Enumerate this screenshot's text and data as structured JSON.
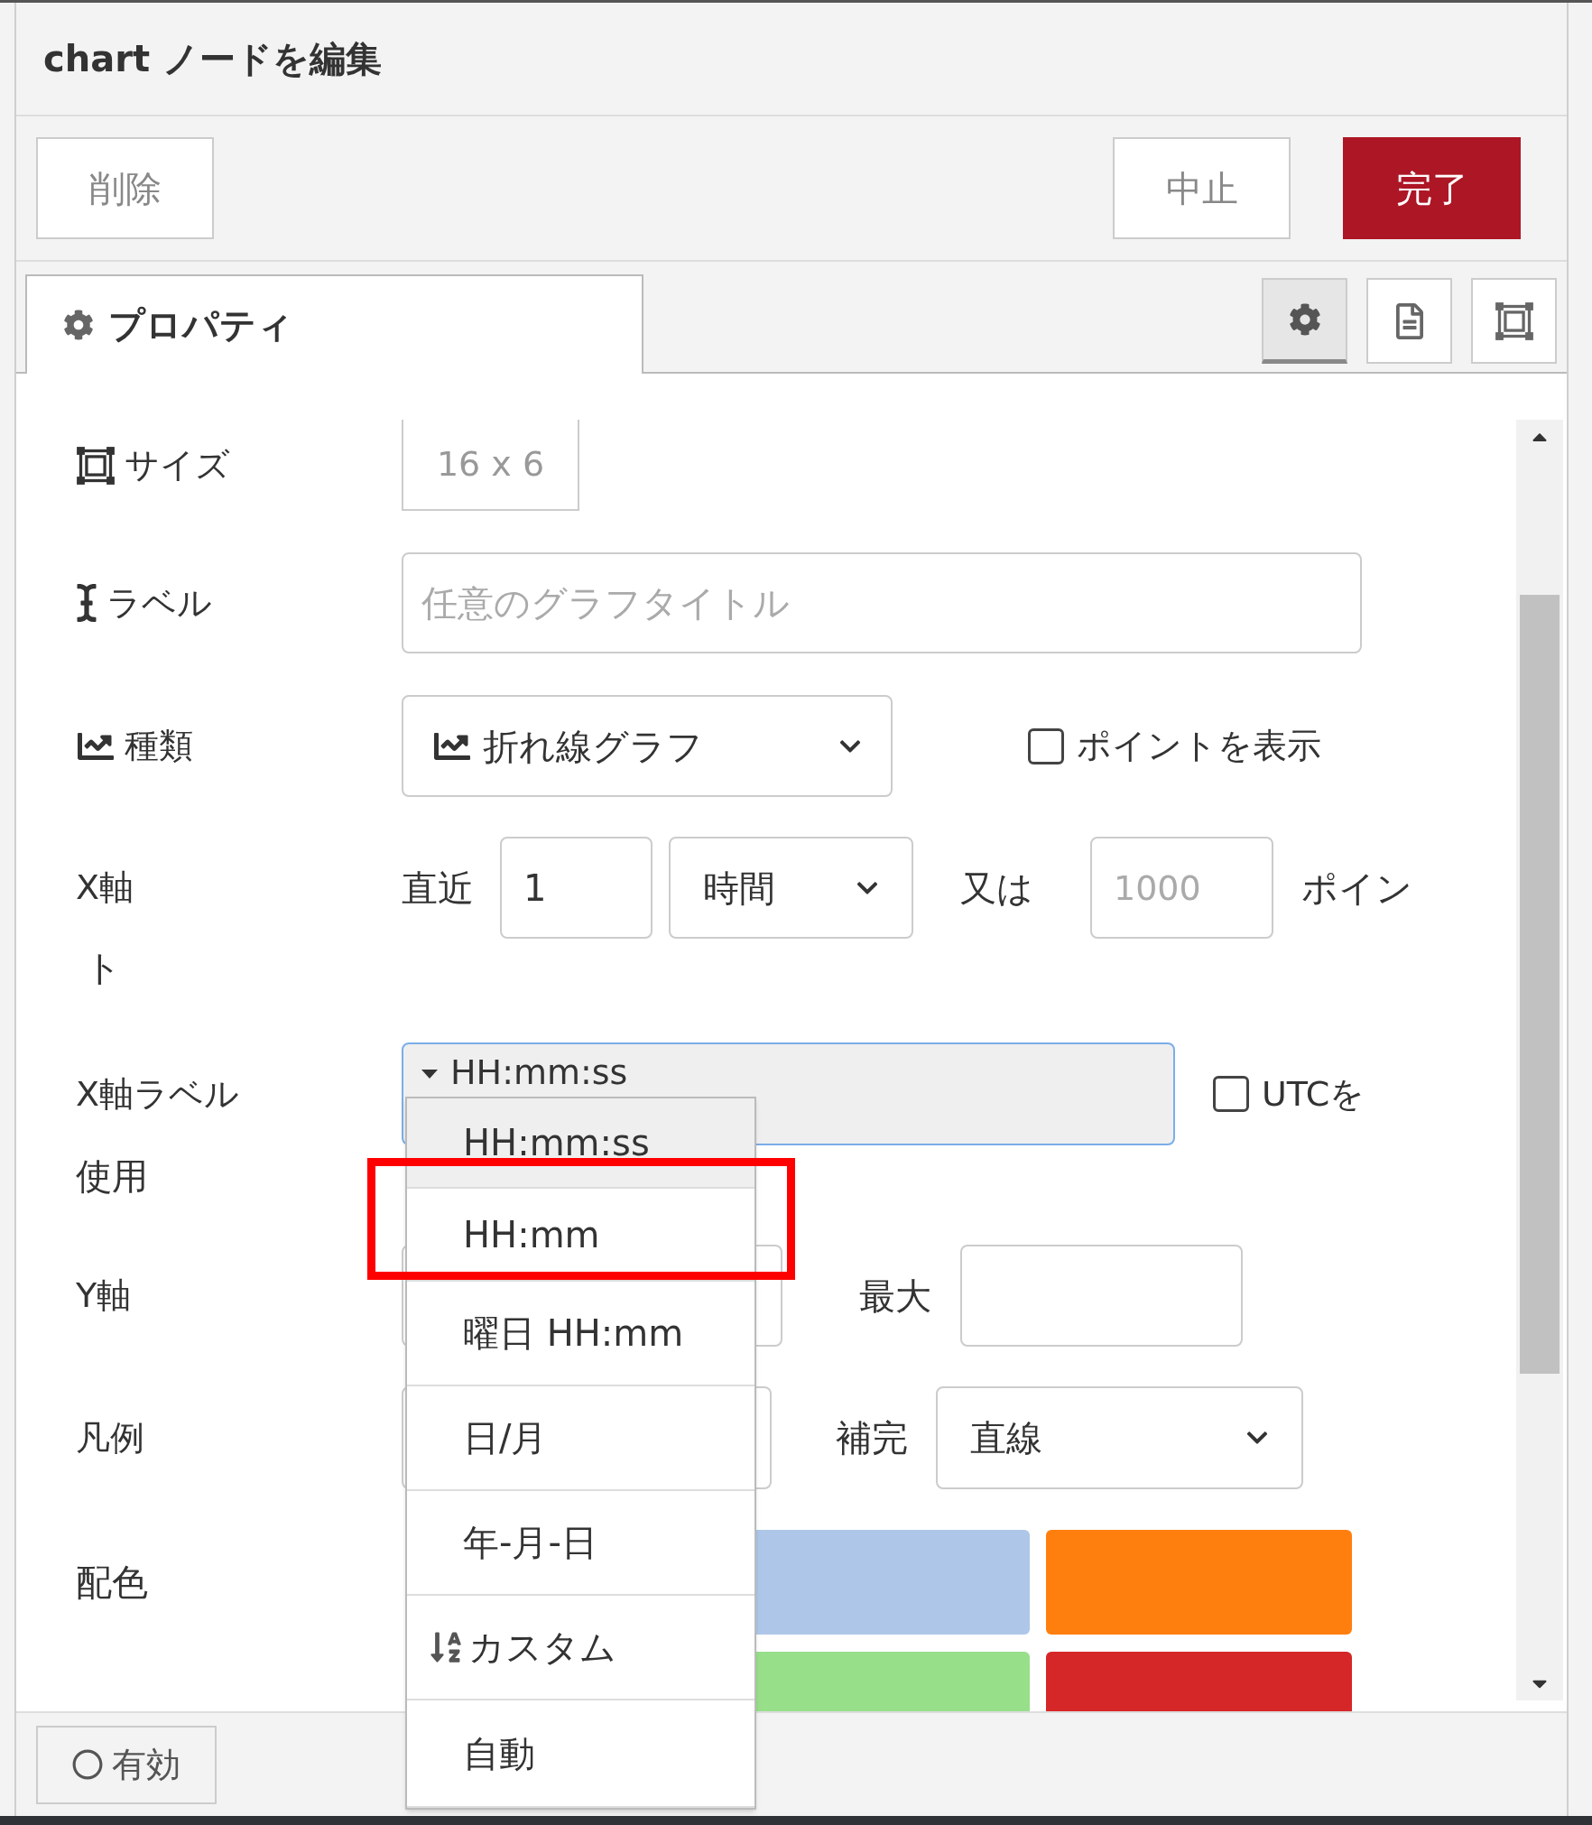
{
  "dialog": {
    "title": "chart ノードを編集"
  },
  "buttons": [
    {
      "label": "削除",
      "kind": "secondary"
    },
    {
      "label": "中止",
      "kind": "secondary"
    },
    {
      "label": "完了",
      "kind": "primary"
    }
  ],
  "tabs": [
    {
      "label": "プロパティ",
      "selected": true
    }
  ],
  "side_tabs": [
    {
      "kind": "gear",
      "selected": true
    },
    {
      "kind": "document",
      "selected": false
    },
    {
      "kind": "frame",
      "selected": false
    }
  ],
  "size": {
    "label": "サイズ",
    "value": "16 x 6"
  },
  "label_field": {
    "label": "ラベル",
    "placeholder": "任意のグラフタイトル"
  },
  "type": {
    "label": "種類",
    "value": "折れ線グラフ",
    "checkbox": {
      "label": "ポイントを表示",
      "checked": false
    }
  },
  "x_axis": {
    "label": "X軸",
    "label_wrap": "ト",
    "last_label": "直近",
    "last_value": "1",
    "unit": "時間",
    "or_label": "又は",
    "points_placeholder": "1000",
    "points_label": "ポイン"
  },
  "x_label": {
    "label": "X軸ラベル",
    "label_wrap": "使用",
    "value": "HH:mm:ss",
    "utc": {
      "label": "UTCを",
      "checked": false
    }
  },
  "y_axis": {
    "label": "Y軸",
    "max_label": "最大"
  },
  "legend": {
    "label": "凡例",
    "interpolate_label": "補完",
    "interpolate_value": "直線"
  },
  "colors": {
    "label": "配色",
    "swatches": [
      {
        "color": "#aec7e8"
      },
      {
        "color": "#ff7f0e"
      },
      {
        "color": "#98df8a"
      },
      {
        "color": "#d62728"
      }
    ]
  },
  "footer": {
    "toggle_label": "有効"
  },
  "dropdown": {
    "options": [
      {
        "label": "HH:mm:ss",
        "selected": true,
        "highlighted": false
      },
      {
        "label": "HH:mm",
        "selected": false,
        "highlighted": true
      },
      {
        "label": "曜日 HH:mm",
        "selected": false,
        "highlighted": false
      },
      {
        "label": "日/月",
        "selected": false,
        "highlighted": false
      },
      {
        "label": "年-月-日",
        "selected": false,
        "highlighted": false
      },
      {
        "label": "カスタム",
        "selected": false,
        "highlighted": false,
        "kind": "custom"
      },
      {
        "label": "自動",
        "selected": false,
        "highlighted": false
      }
    ]
  }
}
